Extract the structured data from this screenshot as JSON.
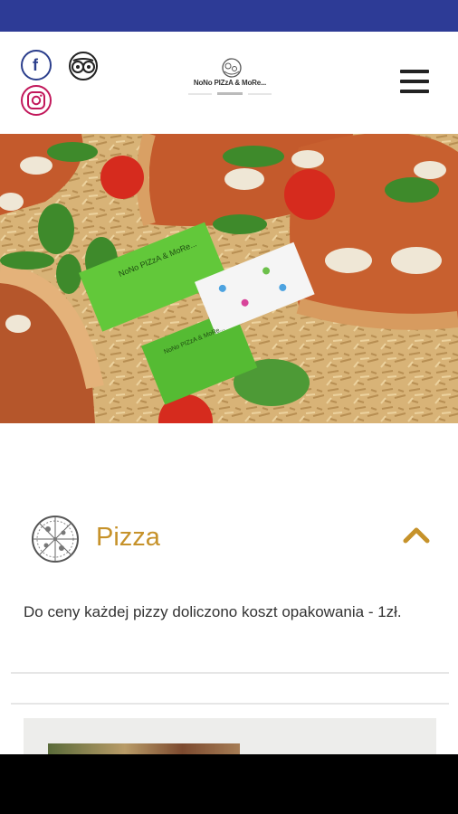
{
  "header": {
    "logo_text": "NoNo PIZzA & MoRe...",
    "social": {
      "facebook": "facebook-icon",
      "tripadvisor": "tripadvisor-icon",
      "instagram": "instagram-icon"
    },
    "menu_icon": "hamburger-menu-icon"
  },
  "hero": {
    "card_text_primary": "NoNo PIZzA & MoRe...",
    "card_text_secondary": "NoNo PIZzA & MoRe..."
  },
  "section": {
    "title": "Pizza",
    "icon": "pizza-icon",
    "toggle_icon": "chevron-up-icon",
    "description": "Do ceny każdej pizzy doliczono koszt opakowania - 1zł."
  },
  "colors": {
    "status_bar": "#2d3b96",
    "accent": "#c6922a",
    "navbar": "#000000"
  }
}
